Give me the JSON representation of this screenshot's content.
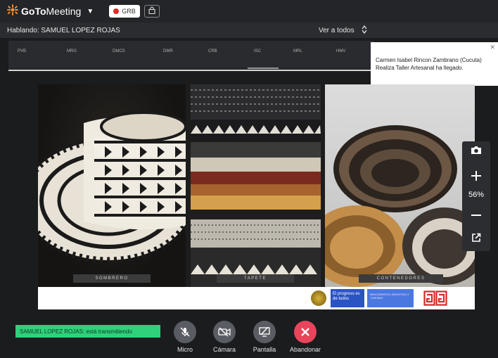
{
  "app": {
    "brand_goto": "GoTo",
    "brand_meeting": "Meeting",
    "rec_label": "GRB"
  },
  "speakerbar": {
    "speaking": "Hablando: SAMUEL LOPEZ ROJAS",
    "view_all": "Ver a todos"
  },
  "ruler": {
    "items": [
      "PVB",
      "MRG",
      "DMCS",
      "DMR",
      "CRB",
      "ISC",
      "MRL",
      "HMV"
    ]
  },
  "notification": {
    "text": "Carmen Isabel Rincon Zambrano (Cucuta) Realiza Taller Artesanal ha llegado."
  },
  "shared_screen": {
    "captions": [
      "SOMBRERO",
      "TAPETE",
      "CONTENEDORES"
    ],
    "banner": {
      "progreso": "El progreso es de todos",
      "ministry": "MINCOMERCIO INDUSTRIA Y TURISMO"
    }
  },
  "zoom": {
    "level": "56%"
  },
  "bottombar": {
    "speaker_tag": "SAMUEL LOPEZ ROJAS: está transmitiendo",
    "controls": {
      "micro": "Micro",
      "camara": "Cámara",
      "pantalla": "Pantalla",
      "abandonar": "Abandonar"
    }
  },
  "colors": {
    "accent_green": "#2fd17b",
    "leave_red": "#e8455b",
    "rec_red": "#e02a2a",
    "brand_orange": "#f68d2e"
  },
  "icons": [
    "gotomeeting-logo-icon",
    "chevron-down-icon",
    "record-dot-icon",
    "lock-icon",
    "updown-arrows-icon",
    "close-icon",
    "camera-snapshot-icon",
    "plus-icon",
    "minus-icon",
    "popout-icon",
    "mic-off-icon",
    "camera-off-icon",
    "screen-share-icon",
    "close-x-icon"
  ]
}
